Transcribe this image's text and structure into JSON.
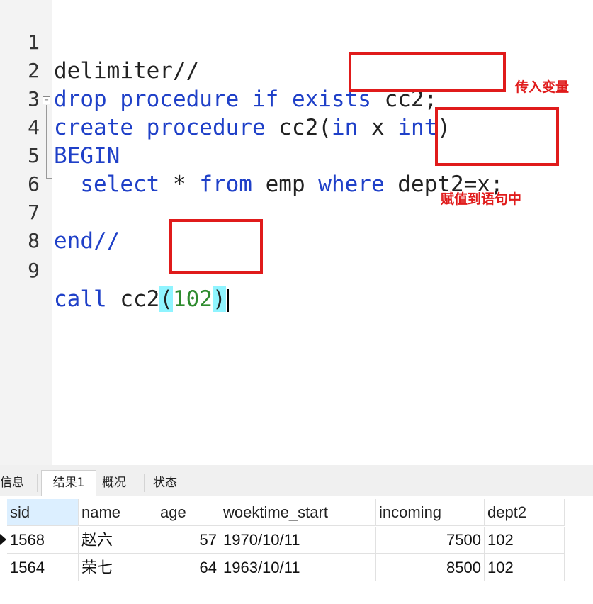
{
  "editor": {
    "lines": [
      {
        "n": "1"
      },
      {
        "n": "2"
      },
      {
        "n": "3"
      },
      {
        "n": "4"
      },
      {
        "n": "5"
      },
      {
        "n": "6"
      },
      {
        "n": "7"
      },
      {
        "n": "8"
      },
      {
        "n": "9"
      }
    ],
    "tokens": {
      "l1": "delimiter//",
      "l2_kw": "drop procedure if exists",
      "l2_rest": " cc2;",
      "l3_kw": "create procedure",
      "l3_name": " cc2",
      "l3_open": "(",
      "l3_in": "in",
      "l3_x": " x ",
      "l3_int": "int",
      "l3_close": ")",
      "l4": "BEGIN",
      "l5_indent": "  ",
      "l5_select": "select",
      "l5_star": " * ",
      "l5_from": "from",
      "l5_emp": " emp ",
      "l5_where": "where",
      "l5_cond": " dept2=x;",
      "l7": "end//",
      "l9_call": "call",
      "l9_name": " cc2",
      "l9_open": "(",
      "l9_num": "102",
      "l9_close": ")"
    }
  },
  "annotations": {
    "pass_variable": "传入变量",
    "assign_to_statement": "赋值到语句中"
  },
  "colors": {
    "keyword": "#1f40c8",
    "number": "#2e8b2e",
    "annotation_red": "#e01b1b",
    "bracket_highlight": "#8ff4ff"
  },
  "tabs": [
    "信息",
    "结果1",
    "概况",
    "状态"
  ],
  "active_tab": "结果1",
  "results": {
    "columns": [
      "sid",
      "name",
      "age",
      "woektime_start",
      "incoming",
      "dept2"
    ],
    "rows": [
      [
        "1568",
        "赵六",
        "57",
        "1970/10/11",
        "7500",
        "102"
      ],
      [
        "1564",
        "荣七",
        "64",
        "1963/10/11",
        "8500",
        "102"
      ]
    ]
  }
}
